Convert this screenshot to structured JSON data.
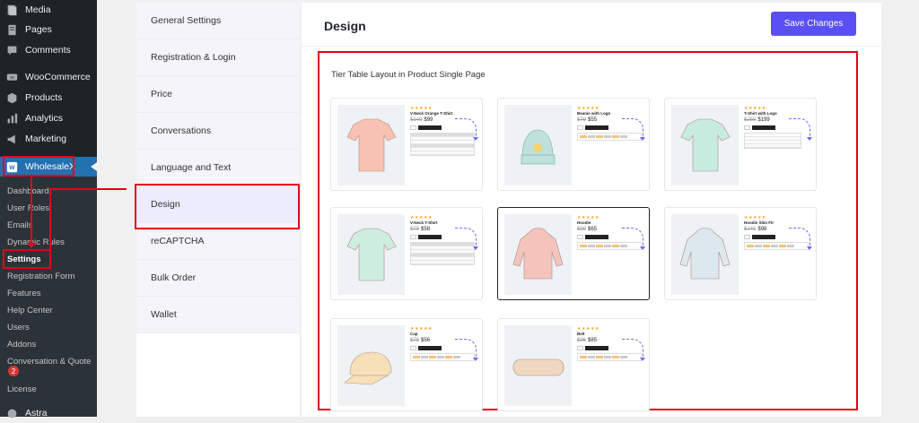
{
  "wp_menu": {
    "items": [
      {
        "label": "Media",
        "icon": "media-icon"
      },
      {
        "label": "Pages",
        "icon": "pages-icon"
      },
      {
        "label": "Comments",
        "icon": "comments-icon"
      },
      {
        "label": "WooCommerce",
        "icon": "woocommerce-icon"
      },
      {
        "label": "Products",
        "icon": "products-icon"
      },
      {
        "label": "Analytics",
        "icon": "analytics-icon"
      },
      {
        "label": "Marketing",
        "icon": "marketing-icon"
      }
    ],
    "plugin": {
      "label": "WholesaleX",
      "icon": "wholesalex-icon"
    },
    "submenu": [
      "Dashboard",
      "User Roles",
      "Emails",
      "Dynamic Rules",
      "Settings",
      "Registration Form",
      "Features",
      "Help Center",
      "Users",
      "Addons",
      "Conversation & Quote",
      "License"
    ],
    "current_submenu": "Settings",
    "conversation_badge": "2",
    "bottom_item": {
      "label": "Astra",
      "icon": "astra-icon"
    }
  },
  "settings_nav": {
    "items": [
      "General Settings",
      "Registration & Login",
      "Price",
      "Conversations",
      "Language and Text",
      "Design",
      "reCAPTCHA",
      "Bulk Order",
      "Wallet"
    ],
    "active": "Design"
  },
  "main": {
    "title": "Design",
    "save_label": "Save Changes",
    "section_title": "Tier Table Layout in Product Single Page",
    "layouts": [
      {
        "name": "V-Neck Orange T-Shirt",
        "old": "$149",
        "price": "$99",
        "style": "table",
        "selected": false
      },
      {
        "name": "Beanie with Logo",
        "old": "$79",
        "price": "$55",
        "style": "chips",
        "selected": false
      },
      {
        "name": "T-Shirt with Logo",
        "old": "$259",
        "price": "$199",
        "style": "list",
        "selected": false
      },
      {
        "name": "V-Neck T-Shirt",
        "old": "$79",
        "price": "$58",
        "style": "table",
        "selected": false
      },
      {
        "name": "Hoodie",
        "old": "$99",
        "price": "$65",
        "style": "chips",
        "selected": true
      },
      {
        "name": "Hoodie Slim Fit",
        "old": "$140",
        "price": "$98",
        "style": "chips",
        "selected": false
      },
      {
        "name": "Cap",
        "old": "$79",
        "price": "$56",
        "style": "chips",
        "selected": false
      },
      {
        "name": "Belt",
        "old": "$96",
        "price": "$85",
        "style": "chips",
        "selected": false
      }
    ],
    "stars": "★★★★★"
  },
  "colors": {
    "wp_sidebar": "#1d2327",
    "wp_accent": "#2271b1",
    "primary_button": "#5a4ff5",
    "highlight_box": "#e3001b"
  }
}
